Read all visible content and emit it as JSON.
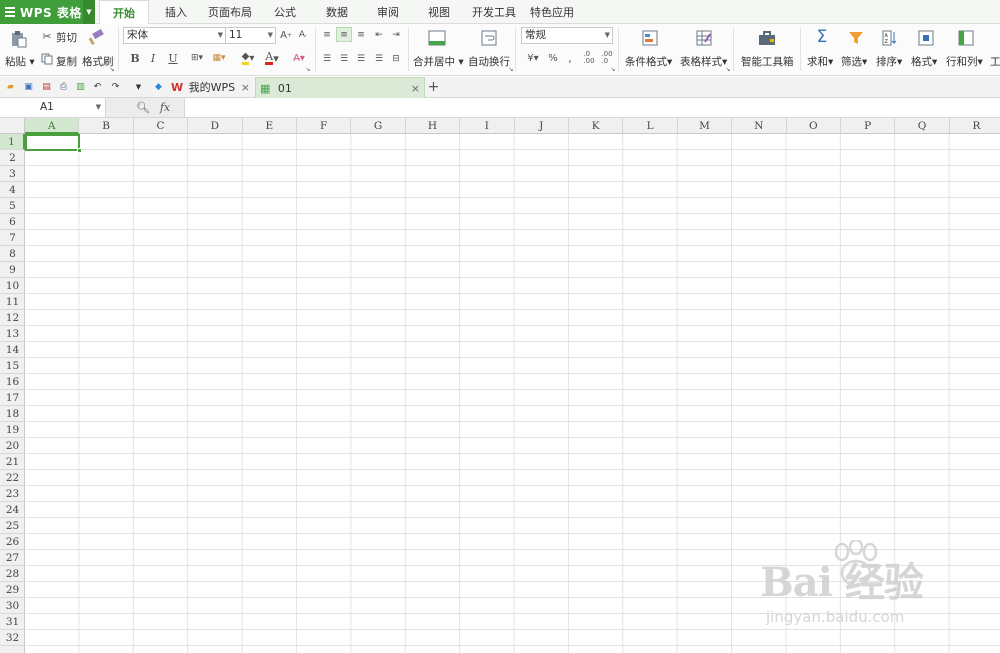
{
  "app": {
    "title": "WPS 表格"
  },
  "menu": {
    "tabs": [
      {
        "label": "开始"
      },
      {
        "label": "插入"
      },
      {
        "label": "页面布局"
      },
      {
        "label": "公式"
      },
      {
        "label": "数据"
      },
      {
        "label": "审阅"
      },
      {
        "label": "视图"
      },
      {
        "label": "开发工具"
      },
      {
        "label": "特色应用"
      }
    ]
  },
  "ribbon": {
    "paste": "粘贴",
    "cut": "剪切",
    "copy": "复制",
    "format_painter": "格式刷",
    "font_name": "宋体",
    "font_size": "11",
    "bold": "B",
    "italic": "I",
    "underline": "U",
    "merge_center": "合并居中",
    "wrap_text": "自动换行",
    "number_format": "常规",
    "percent": "%",
    "conditional_format": "条件格式",
    "table_style": "表格样式",
    "smart_toolbox": "智能工具箱",
    "sum": "求和",
    "filter": "筛选",
    "sort": "排序",
    "format": "格式",
    "row_col": "行和列",
    "work": "工"
  },
  "doc_tabs": [
    {
      "label": "我的WPS"
    },
    {
      "label": "01"
    }
  ],
  "formula_bar": {
    "cell_ref": "A1",
    "fx": "fx",
    "value": ""
  },
  "grid": {
    "columns": [
      "A",
      "B",
      "C",
      "D",
      "E",
      "F",
      "G",
      "H",
      "I",
      "J",
      "K",
      "L",
      "M",
      "N",
      "O",
      "P",
      "Q",
      "R"
    ],
    "rows": [
      "1",
      "2",
      "3",
      "4",
      "5",
      "6",
      "7",
      "8",
      "9",
      "10",
      "11",
      "12",
      "13",
      "14",
      "15",
      "16",
      "17",
      "18",
      "19",
      "20",
      "21",
      "22",
      "23",
      "24",
      "25",
      "26",
      "27",
      "28",
      "29",
      "30",
      "31",
      "32"
    ],
    "active_cell": "A1"
  },
  "watermark": {
    "brand": "Bai 经验",
    "url": "jingyan.baidu.com"
  },
  "colors": {
    "brand_green": "#3f9d3a",
    "selection_green": "#4aa03f"
  }
}
